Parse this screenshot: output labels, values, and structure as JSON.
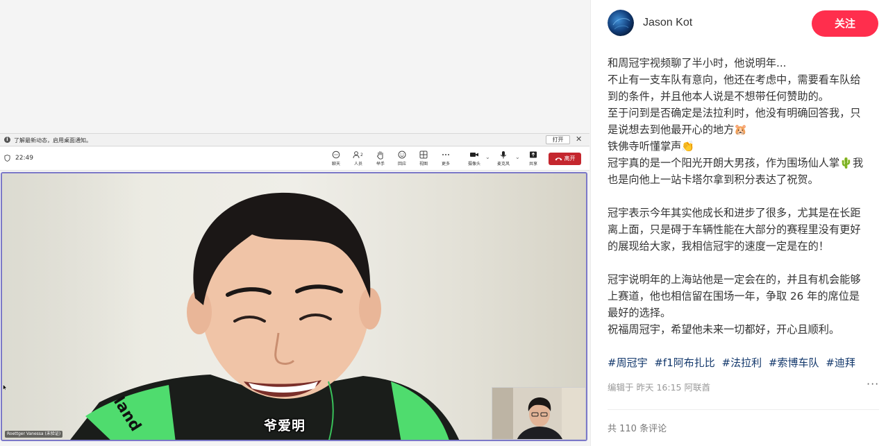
{
  "meeting": {
    "notification": {
      "icon": "info-icon",
      "message": "了解最新动态，启用桌面通知。",
      "open_label": "打开",
      "close_label": "✕"
    },
    "toolbar": {
      "time": "22:49",
      "buttons": [
        {
          "icon": "chat-icon",
          "label": "聊天",
          "glyph": "💬"
        },
        {
          "icon": "people-icon",
          "label": "人员",
          "glyph": "👥",
          "badge": "2"
        },
        {
          "icon": "raise-hand-icon",
          "label": "举手",
          "glyph": "✋"
        },
        {
          "icon": "reaction-icon",
          "label": "回应",
          "glyph": "☺"
        },
        {
          "icon": "view-icon",
          "label": "视图",
          "glyph": "⊞"
        },
        {
          "icon": "more-icon",
          "label": "更多",
          "glyph": "···"
        },
        {
          "icon": "camera-icon",
          "label": "摄像头",
          "glyph": "▶"
        },
        {
          "icon": "mic-icon",
          "label": "麦克风",
          "glyph": "🎙"
        },
        {
          "icon": "share-icon",
          "label": "共享",
          "glyph": "⬆"
        }
      ],
      "leave_label": "离开",
      "leave_color": "#c4262e"
    },
    "video": {
      "participant_name": "Roettger Vanessa (未验证)",
      "subtitle": "爷爱明"
    }
  },
  "post": {
    "author": "Jason Kot",
    "follow_label": "关注",
    "follow_color": "#ff2e4d",
    "lines": [
      "和周冠宇视频聊了半小时，他说明年...",
      "不止有一支车队有意向，他还在考虑中，需要看车队给",
      "到的条件，并且他本人说是不想带任何赞助的。",
      "至于问到是否确定是法拉利时，他没有明确回答我，只",
      "是说想去到他最开心的地方🐹",
      "铁佛寺听懂掌声👏",
      "冠宇真的是一个阳光开朗大男孩，作为围场仙人掌🌵我",
      "也是向他上一站卡塔尔拿到积分表达了祝贺。",
      "",
      "冠宇表示今年其实他成长和进步了很多，尤其是在长距",
      "离上面，只是碍于车辆性能在大部分的赛程里没有更好",
      "的展现给大家，我相信冠宇的速度一定是在的！",
      "",
      "冠宇说明年的上海站他是一定会在的，并且有机会能够",
      "上赛道，他也相信留在围场一年，争取 26 年的席位是",
      "最好的选择。",
      "祝福周冠宇，希望他未来一切都好，开心且顺利。"
    ],
    "tags": [
      "#周冠宇",
      "#f1阿布扎比",
      "#法拉利",
      "#索博车队",
      "#迪拜"
    ],
    "meta": "编辑于  昨天 16:15 阿联酋",
    "more_label": "···",
    "comments": "共 110 条评论",
    "tag_color": "#13386c"
  }
}
